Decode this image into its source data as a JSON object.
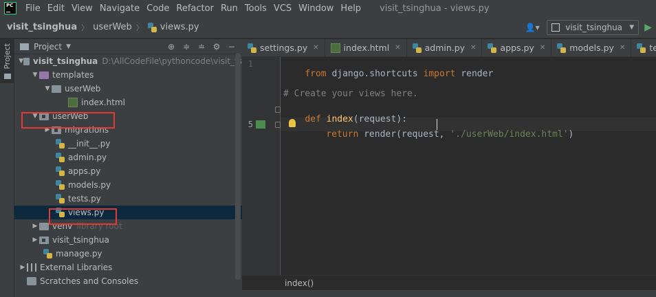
{
  "menubar": {
    "logo_text": "PC",
    "items": [
      "File",
      "Edit",
      "View",
      "Navigate",
      "Code",
      "Refactor",
      "Run",
      "Tools",
      "VCS",
      "Window",
      "Help"
    ],
    "window_title": "visit_tsinghua - views.py"
  },
  "navbar": {
    "project": "visit_tsinghua",
    "folder": "userWeb",
    "file": "views.py",
    "run_config": "visit_tsinghua"
  },
  "toolstripe": {
    "project_tab": "Project"
  },
  "project_panel": {
    "title": "Project",
    "tree": {
      "root_name": "visit_tsinghua",
      "root_path": "D:\\AllCodeFile\\pythoncode\\visit_ts",
      "templates": "templates",
      "templates_userweb": "userWeb",
      "index_html": "index.html",
      "userweb": "userWeb",
      "migrations": "migrations",
      "init_py": "__init__.py",
      "admin_py": "admin.py",
      "apps_py": "apps.py",
      "models_py": "models.py",
      "tests_py": "tests.py",
      "views_py": "views.py",
      "venv": "venv",
      "venv_hint": "library root",
      "visit_tsinghua_pkg": "visit_tsinghua",
      "manage_py": "manage.py",
      "external_libraries": "External Libraries",
      "scratches": "Scratches and Consoles"
    }
  },
  "editor_tabs": [
    "settings.py",
    "index.html",
    "admin.py",
    "apps.py",
    "models.py",
    "tests.py"
  ],
  "editor": {
    "line_numbers": {
      "l1": "1",
      "l5": "5"
    },
    "code": {
      "l1_from": "from",
      "l1_mod": " django.shortcuts ",
      "l1_import": "import",
      "l1_name": " render",
      "l3_comment": "# Create your views here.",
      "l4_def": "def",
      "l4_fn": " index",
      "l4_rest": "(request):",
      "l5_return": "return",
      "l5_mid": " render(request, ",
      "l5_str": "'./userWeb/index.html'",
      "l5_end": ")"
    },
    "breadcrumb": "index()"
  }
}
